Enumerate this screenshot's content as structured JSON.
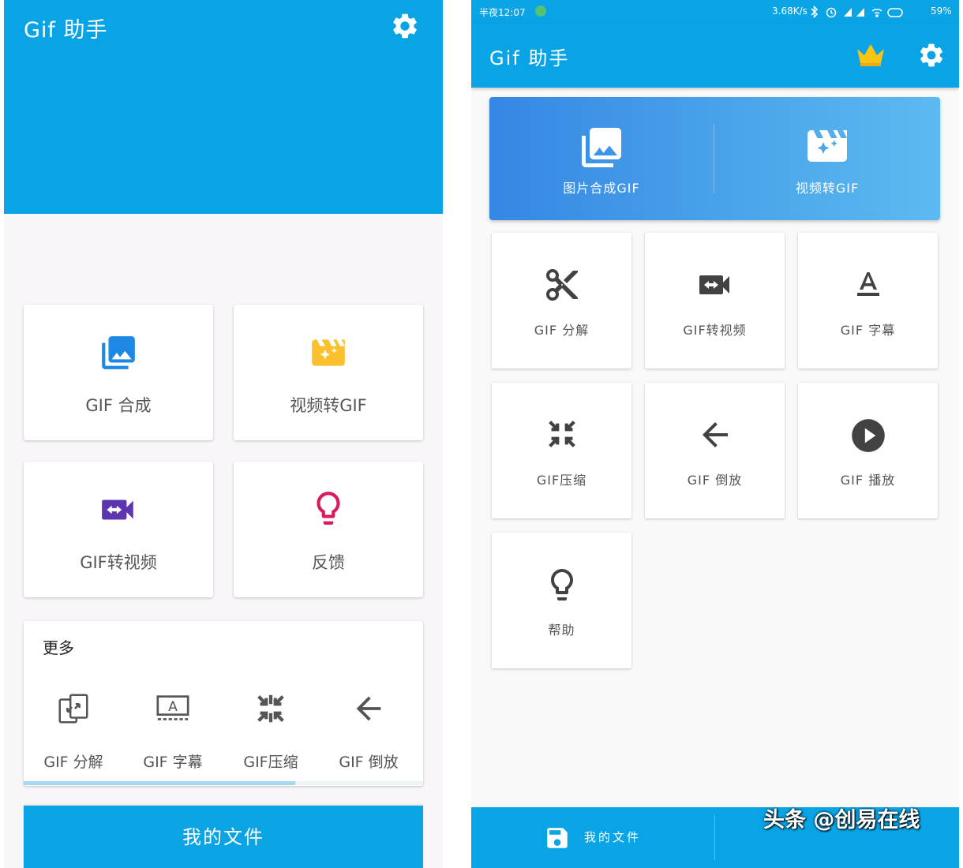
{
  "left": {
    "app_title": "Gif 助手",
    "cards": [
      {
        "label": "GIF 合成",
        "icon": "image-gallery-icon",
        "color": "#1e88e5"
      },
      {
        "label": "视频转GIF",
        "icon": "video-sparkle-icon",
        "color": "#fbc02d"
      },
      {
        "label": "GIF转视频",
        "icon": "video-convert-icon",
        "color": "#5e35b1"
      },
      {
        "label": "反馈",
        "icon": "lightbulb-icon",
        "color": "#d81b60"
      }
    ],
    "more": {
      "title": "更多",
      "items": [
        {
          "label": "GIF 分解",
          "icon": "split-icon"
        },
        {
          "label": "GIF 字幕",
          "icon": "subtitle-icon"
        },
        {
          "label": "GIF压缩",
          "icon": "compress-icon"
        },
        {
          "label": "GIF 倒放",
          "icon": "arrow-left-icon"
        }
      ],
      "scroll_progress": 0.68
    },
    "bottom_button": "我的文件"
  },
  "right": {
    "status": {
      "carrier_time": "半夜12:07",
      "speed": "3.68K/s",
      "battery": "59%"
    },
    "app_title": "Gif 助手",
    "banner": [
      {
        "label": "图片合成GIF",
        "icon": "image-gallery-icon"
      },
      {
        "label": "视频转GIF",
        "icon": "video-sparkle-icon"
      }
    ],
    "grid": [
      {
        "label": "GIF 分解",
        "icon": "scissors-icon"
      },
      {
        "label": "GIF转视频",
        "icon": "video-convert-icon"
      },
      {
        "label": "GIF 字幕",
        "icon": "text-format-icon"
      },
      {
        "label": "GIF压缩",
        "icon": "compress-icon"
      },
      {
        "label": "GIF 倒放",
        "icon": "arrow-left-icon"
      },
      {
        "label": "GIF 播放",
        "icon": "play-icon"
      },
      {
        "label": "帮助",
        "icon": "lightbulb-icon"
      }
    ],
    "bottom_button": "我的文件",
    "watermark": "头条 @创易在线"
  }
}
